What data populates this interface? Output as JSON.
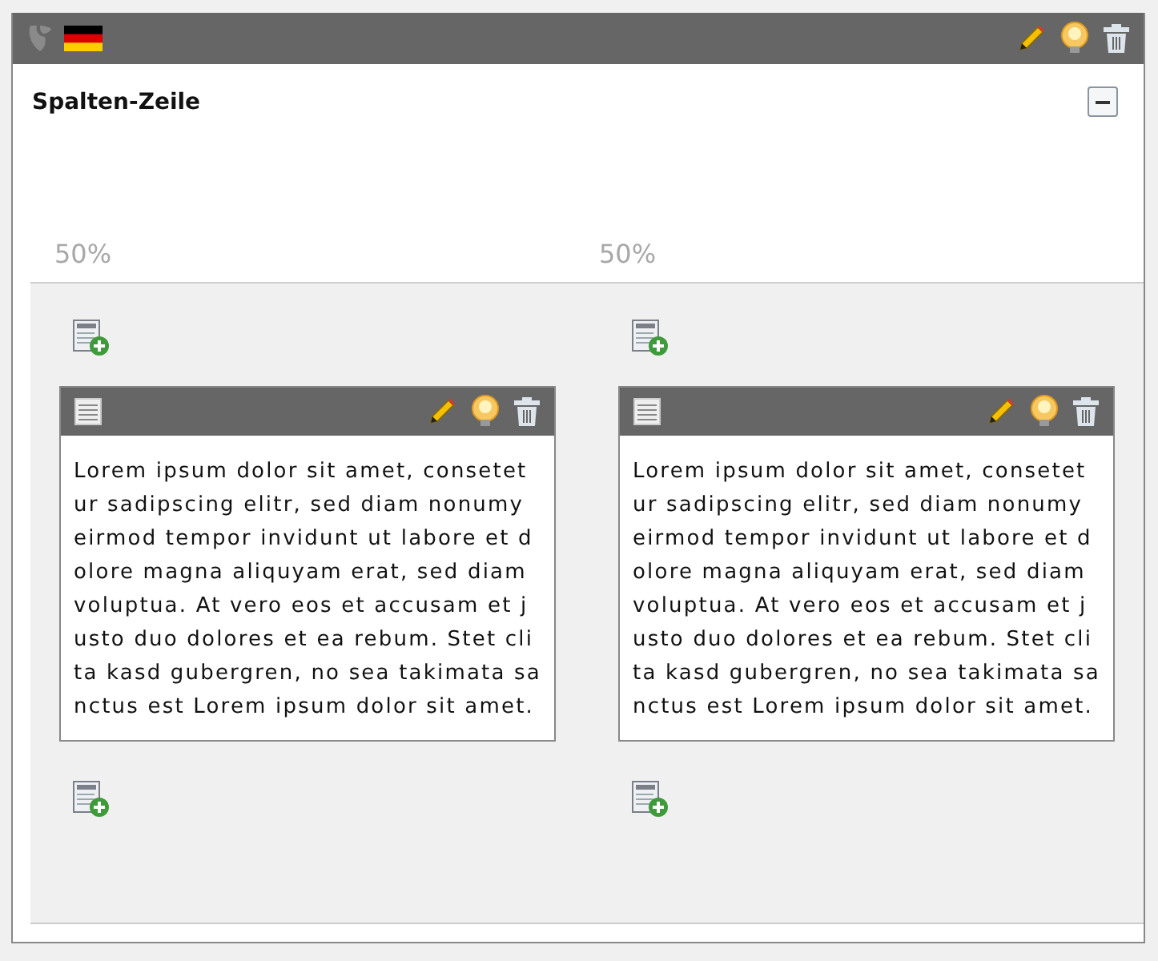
{
  "title": "Spalten-Zeile",
  "columns": [
    {
      "width_label": "50%",
      "elements": [
        {
          "text": "Lorem ipsum dolor sit amet, consetetur sadipscing elitr, sed diam nonumy eirmod tempor invidunt ut labore et dolore magna aliquyam erat, sed diam voluptua. At vero eos et accusam et justo duo dolores et ea rebum. Stet clita kasd gubergren, no sea takimata sanctus est Lorem ipsum dolor sit amet."
        }
      ]
    },
    {
      "width_label": "50%",
      "elements": [
        {
          "text": "Lorem ipsum dolor sit amet, consetetur sadipscing elitr, sed diam nonumy eirmod tempor invidunt ut labore et dolore magna aliquyam erat, sed diam voluptua. At vero eos et accusam et justo duo dolores et ea rebum. Stet clita kasd gubergren, no sea takimata sanctus est Lorem ipsum dolor sit amet."
        }
      ]
    }
  ]
}
